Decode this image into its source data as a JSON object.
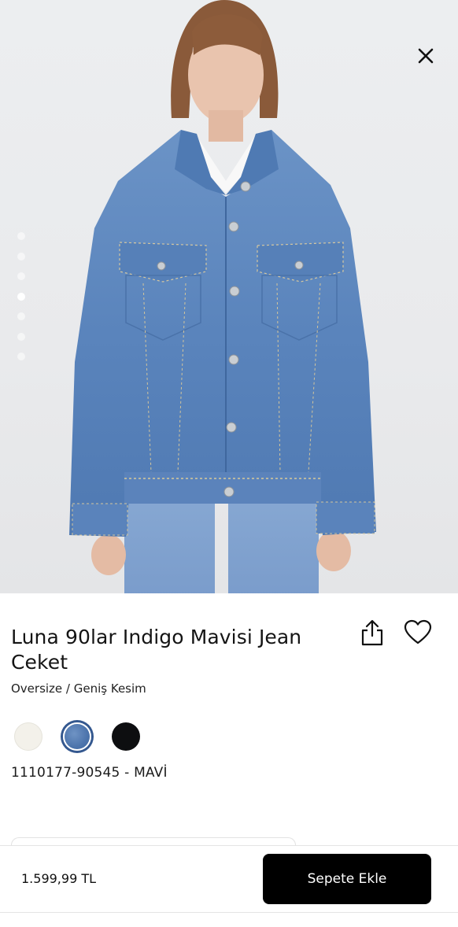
{
  "product": {
    "title": "Luna 90lar Indigo Mavisi Jean Ceket",
    "fit": "Oversize / Geniş Kesim",
    "sku_color": "1110177-90545 - MAVİ",
    "price": "1.599,99 TL"
  },
  "gallery": {
    "image_count": 7,
    "active_index": 3,
    "close_icon": "close-icon"
  },
  "actions": {
    "share_icon": "share-icon",
    "favorite_icon": "heart-icon",
    "add_to_cart": "Sepete Ekle"
  },
  "colors": {
    "swatches": [
      {
        "name": "cream",
        "hex": "#f3f1ea"
      },
      {
        "name": "denim",
        "hex": "#4c74ac",
        "selected": true
      },
      {
        "name": "black",
        "hex": "#0d0e10"
      }
    ],
    "accent": "#000000"
  }
}
